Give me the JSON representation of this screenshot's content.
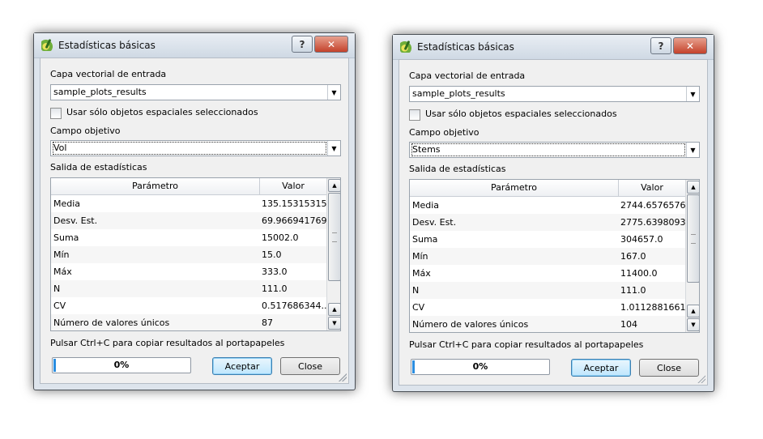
{
  "dialogs": [
    {
      "title": "Estadísticas básicas",
      "help_label": "?",
      "close_x_label": "✕",
      "input_layer_label": "Capa vectorial de entrada",
      "input_layer_value": "sample_plots_results",
      "selected_only_label": "Usar sólo objetos espaciales seleccionados",
      "target_field_label": "Campo objetivo",
      "target_field_value": "Vol",
      "output_label": "Salida de estadísticas",
      "table": {
        "headers": [
          "Parámetro",
          "Valor"
        ],
        "rows": [
          [
            "Media",
            "135.153153153"
          ],
          [
            "Desv. Est.",
            "69.966941769"
          ],
          [
            "Suma",
            "15002.0"
          ],
          [
            "Mín",
            "15.0"
          ],
          [
            "Máx",
            "333.0"
          ],
          [
            "N",
            "111.0"
          ],
          [
            "CV",
            "0.517686344..."
          ],
          [
            "Número de valores únicos",
            "87"
          ]
        ]
      },
      "hint": "Pulsar Ctrl+C para copiar resultados al portapapeles",
      "progress": "0%",
      "progress_value": 0,
      "accept_label": "Aceptar",
      "close_label": "Close"
    },
    {
      "title": "Estadísticas básicas",
      "help_label": "?",
      "close_x_label": "✕",
      "input_layer_label": "Capa vectorial de entrada",
      "input_layer_value": "sample_plots_results",
      "selected_only_label": "Usar sólo objetos espaciales seleccionados",
      "target_field_label": "Campo objetivo",
      "target_field_value": "Stems",
      "output_label": "Salida de estadísticas",
      "table": {
        "headers": [
          "Parámetro",
          "Valor"
        ],
        "rows": [
          [
            "Media",
            "2744.65765766"
          ],
          [
            "Desv. Est.",
            "2775.63980935"
          ],
          [
            "Suma",
            "304657.0"
          ],
          [
            "Mín",
            "167.0"
          ],
          [
            "Máx",
            "11400.0"
          ],
          [
            "N",
            "111.0"
          ],
          [
            "CV",
            "1.01128816616"
          ],
          [
            "Número de valores únicos",
            "104"
          ]
        ]
      },
      "hint": "Pulsar Ctrl+C para copiar resultados al portapapeles",
      "progress": "0%",
      "progress_value": 0,
      "accept_label": "Aceptar",
      "close_label": "Close"
    }
  ]
}
